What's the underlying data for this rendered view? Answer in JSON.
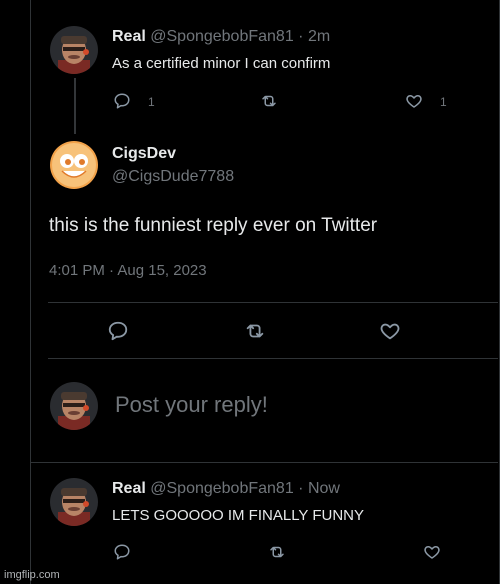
{
  "reply1": {
    "name": "Real",
    "handle": "@SpongebobFan81",
    "separator": "·",
    "time": "2m",
    "text": "As a certified minor I can confirm",
    "reply_count": "1",
    "like_count": "1",
    "avatar_icon": "heavy-avatar"
  },
  "main_tweet": {
    "name": "CigsDev",
    "handle": "@CigsDude7788",
    "text": "this is the funniest reply ever on Twitter",
    "timestamp": "4:01 PM · Aug 15, 2023",
    "avatar_icon": "smiley-face-avatar"
  },
  "compose": {
    "placeholder": "Post your reply!",
    "avatar_icon": "heavy-avatar"
  },
  "reply2": {
    "name": "Real",
    "handle": "@SpongebobFan81",
    "separator": "·",
    "time": "Now",
    "text": "LETS GOOOOO IM FINALLY FUNNY",
    "avatar_icon": "heavy-avatar"
  },
  "watermark": "imgflip.com",
  "colors": {
    "background": "#000000",
    "text": "#e7e9ea",
    "muted": "#71767b",
    "divider": "#2f3336"
  }
}
